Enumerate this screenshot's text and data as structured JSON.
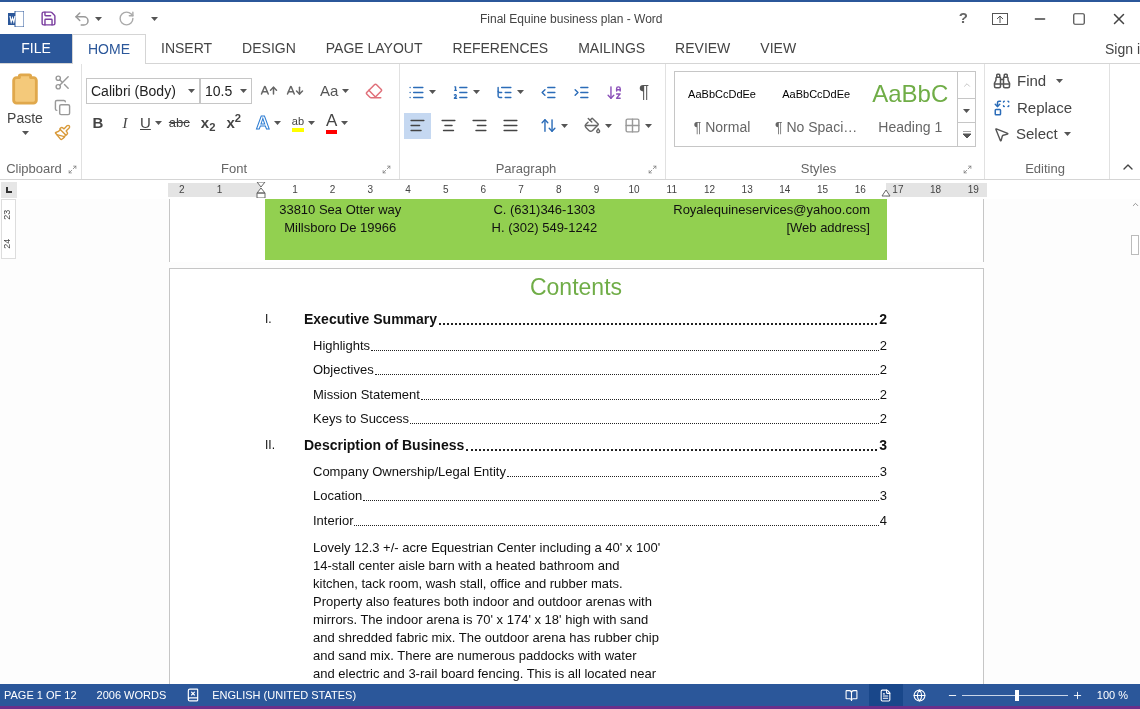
{
  "window": {
    "title": "Final Equine business plan - Word",
    "sign_in": "Sign i",
    "help": "?"
  },
  "tabs": [
    {
      "label": "FILE",
      "kind": "file",
      "selected": false
    },
    {
      "label": "HOME",
      "kind": "tab",
      "selected": true
    },
    {
      "label": "INSERT",
      "kind": "tab",
      "selected": false
    },
    {
      "label": "DESIGN",
      "kind": "tab",
      "selected": false
    },
    {
      "label": "PAGE LAYOUT",
      "kind": "tab",
      "selected": false
    },
    {
      "label": "REFERENCES",
      "kind": "tab",
      "selected": false
    },
    {
      "label": "MAILINGS",
      "kind": "tab",
      "selected": false
    },
    {
      "label": "REVIEW",
      "kind": "tab",
      "selected": false
    },
    {
      "label": "VIEW",
      "kind": "tab",
      "selected": false
    }
  ],
  "ribbon": {
    "clipboard": {
      "label": "Clipboard",
      "paste": "Paste"
    },
    "font": {
      "label": "Font",
      "font_name": "Calibri (Body)",
      "font_size": "10.5",
      "change_case": "Aa",
      "bold": "B",
      "italic": "I",
      "underline": "U",
      "strikethrough": "abc",
      "subscript": "x$_{2}$",
      "superscript": "x$^{2}$",
      "text_effects": "A",
      "highlight": "ab",
      "font_color": "A"
    },
    "paragraph": {
      "label": "Paragraph",
      "show_marks": "¶",
      "alignment": [
        {
          "kind": "left",
          "selected": true
        },
        {
          "kind": "center",
          "selected": false
        },
        {
          "kind": "right",
          "selected": false
        },
        {
          "kind": "justify",
          "selected": false
        }
      ]
    },
    "styles": {
      "label": "Styles",
      "items": [
        {
          "sample": "AaBbCcDdEe",
          "name": "¶ Normal",
          "kind": "body"
        },
        {
          "sample": "AaBbCcDdEe",
          "name": "¶ No Spaci…",
          "kind": "body"
        },
        {
          "sample": "AaBbC",
          "name": "Heading 1",
          "kind": "heading"
        }
      ]
    },
    "editing": {
      "label": "Editing",
      "find": "Find",
      "replace": "Replace",
      "select": "Select"
    }
  },
  "ruler": {
    "marks": [
      "2",
      "1",
      "1",
      "2",
      "3",
      "4",
      "5",
      "6",
      "7",
      "8",
      "9",
      "10",
      "11",
      "12",
      "13",
      "14",
      "15",
      "16",
      "17",
      "18",
      "19"
    ],
    "vertical_marks": [
      "23",
      "24"
    ]
  },
  "document": {
    "header_block": {
      "address": [
        "33810 Sea Otter way",
        "Millsboro De 19966"
      ],
      "phones": [
        "C. (631)346-1303",
        "H. (302) 549-1242"
      ],
      "contact": [
        "Royalequineservices@yahoo.com",
        "[Web address]"
      ]
    },
    "contents_title": "Contents",
    "toc": [
      {
        "number": "I.",
        "title": "Executive Summary",
        "page": "2",
        "children": [
          {
            "title": "Highlights",
            "page": "2"
          },
          {
            "title": "Objectives",
            "page": "2"
          },
          {
            "title": "Mission Statement",
            "page": "2"
          },
          {
            "title": "Keys to Success",
            "page": "2"
          }
        ]
      },
      {
        "number": "II.",
        "title": "Description of Business",
        "page": "3",
        "children": [
          {
            "title": "Company Ownership/Legal Entity",
            "page": "3"
          },
          {
            "title": "Location",
            "page": "3"
          },
          {
            "title": "Interior",
            "page": "4"
          }
        ]
      }
    ],
    "paragraph_lines": [
      "Lovely 12.3 +/- acre Equestrian Center including a 40' x 100'",
      "14-stall center aisle barn with a heated bathroom and",
      "kitchen, tack room, wash stall, office and rubber mats.",
      "Property also features both indoor and outdoor arenas with",
      "mirrors. The indoor arena is 70' x 174' x 18' high with sand",
      "and shredded fabric mix. The outdoor arena has rubber chip",
      "and sand mix. There are numerous paddocks with water",
      "and electric and 3-rail board fencing. This is all located near"
    ]
  },
  "status_bar": {
    "page": "PAGE 1 OF 12",
    "words": "2006 WORDS",
    "language": "ENGLISH (UNITED STATES)",
    "zoom": "100 %",
    "zoom_slider": {
      "level": 0.52
    },
    "views": [
      {
        "kind": "read",
        "selected": false
      },
      {
        "kind": "print",
        "selected": true
      },
      {
        "kind": "web",
        "selected": false
      }
    ]
  }
}
